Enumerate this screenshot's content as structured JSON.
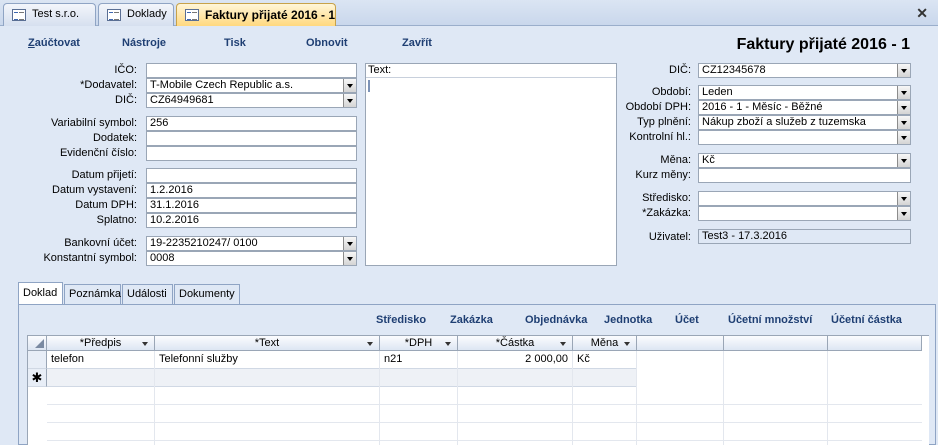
{
  "tabs": [
    {
      "label": "Test s.r.o."
    },
    {
      "label": "Doklady"
    },
    {
      "label": "Faktury přijaté 2016 - 1"
    }
  ],
  "toolbar": {
    "zauctovat_prefix": "Z",
    "zauctovat_rest": "aúčtovat",
    "nastroje": "Nástroje",
    "tisk": "Tisk",
    "obnovit": "Obnovit",
    "zavrit": "Zavřít"
  },
  "form_title": "Faktury přijaté 2016 - 1",
  "left": {
    "ico": {
      "label": "IČO:",
      "value": ""
    },
    "dodavatel": {
      "label": "*Dodavatel:",
      "value": "T-Mobile Czech Republic a.s."
    },
    "dic": {
      "label": "DIČ:",
      "value": "CZ64949681"
    },
    "variabilni": {
      "label": "Variabilní symbol:",
      "value": "256"
    },
    "dodatek": {
      "label": "Dodatek:",
      "value": ""
    },
    "evidencni": {
      "label": "Evidenční číslo:",
      "value": ""
    },
    "datum_prijeti": {
      "label": "Datum přijetí:",
      "value": ""
    },
    "datum_vystaveni": {
      "label": "Datum vystavení:",
      "value": "1.2.2016"
    },
    "datum_dph": {
      "label": "Datum DPH:",
      "value": "31.1.2016"
    },
    "splatno": {
      "label": "Splatno:",
      "value": "10.2.2016"
    },
    "bankovni": {
      "label": "Bankovní účet:",
      "value": "19-2235210247/ 0100"
    },
    "konstantni": {
      "label": "Konstantní symbol:",
      "value": "0008"
    }
  },
  "text_box": {
    "label": "Text:",
    "value": ""
  },
  "right": {
    "dic": {
      "label": "DIČ:",
      "value": "CZ12345678"
    },
    "obdobi": {
      "label": "Období:",
      "value": "Leden"
    },
    "obdobi_dph": {
      "label": "Období DPH:",
      "value": "2016 - 1 - Měsíc - Běžné"
    },
    "typ_plneni": {
      "label": "Typ plnění:",
      "value": "Nákup zboží a služeb z tuzemska"
    },
    "kontrolni": {
      "label": "Kontrolní hl.:",
      "value": ""
    },
    "mena": {
      "label": "Měna:",
      "value": "Kč"
    },
    "kurz": {
      "label": "Kurz měny:",
      "value": ""
    },
    "stredisko": {
      "label": "Středisko:",
      "value": ""
    },
    "zakazka": {
      "label": "*Zakázka:",
      "value": ""
    },
    "uzivatel": {
      "label": "Uživatel:",
      "value": "Test3 - 17.3.2016"
    }
  },
  "subtabs": [
    {
      "label": "Doklad"
    },
    {
      "label": "Poznámka"
    },
    {
      "label": "Události"
    },
    {
      "label": "Dokumenty"
    }
  ],
  "sublinks": {
    "stredisko": "Středisko",
    "zakazka": "Zakázka",
    "objednavka": "Objednávka",
    "jednotka": "Jednotka",
    "ucet": "Účet",
    "ucetni_mnozstvi": "Účetní množství",
    "ucetni_castka": "Účetní částka"
  },
  "grid": {
    "columns": [
      "*Předpis",
      "*Text",
      "*DPH",
      "*Částka",
      "Měna"
    ],
    "rows": [
      [
        "telefon",
        "Telefonní služby",
        "n21",
        "2 000,00",
        "Kč"
      ]
    ],
    "new_row_marker": "✱"
  },
  "colors": {
    "form_bg": "#dfe8f5",
    "link": "#1f3f73",
    "active_tab": "#ffd77b"
  }
}
